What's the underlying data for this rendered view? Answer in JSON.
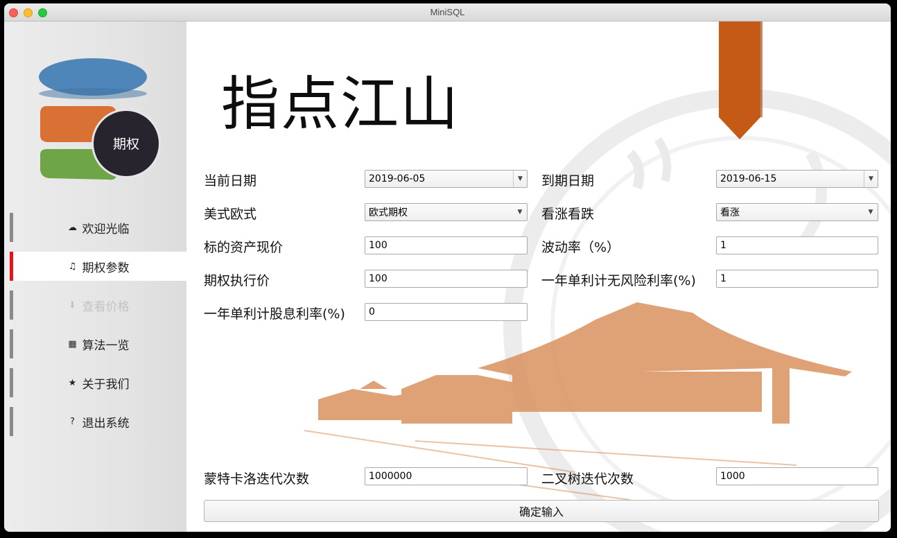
{
  "window": {
    "title": "MiniSQL"
  },
  "logo": {
    "badge": "期权"
  },
  "sidebar": {
    "items": [
      {
        "label": "欢迎光临",
        "icon": "cloud-icon",
        "glyph": "☁",
        "state": "normal"
      },
      {
        "label": "期权参数",
        "icon": "music-note-icon",
        "glyph": "♫",
        "state": "active"
      },
      {
        "label": "查看价格",
        "icon": "download-icon",
        "glyph": "⬇",
        "state": "disabled"
      },
      {
        "label": "算法一览",
        "icon": "film-icon",
        "glyph": "▦",
        "state": "normal"
      },
      {
        "label": "关于我们",
        "icon": "star-icon",
        "glyph": "★",
        "state": "normal"
      },
      {
        "label": "退出系统",
        "icon": "question-icon",
        "glyph": "?",
        "state": "normal"
      }
    ]
  },
  "main": {
    "heading": "指点江山",
    "form": {
      "current_date_label": "当前日期",
      "current_date_value": "2019-06-05",
      "expiry_date_label": "到期日期",
      "expiry_date_value": "2019-06-15",
      "style_label": "美式欧式",
      "style_value": "欧式期权",
      "direction_label": "看涨看跌",
      "direction_value": "看涨",
      "spot_label": "标的资产现价",
      "spot_value": "100",
      "vol_label": "波动率（%）",
      "vol_value": "1",
      "strike_label": "期权执行价",
      "strike_value": "100",
      "rf_label": "一年单利计无风险利率(%)",
      "rf_value": "1",
      "div_label": "一年单利计股息利率(%)",
      "div_value": "0",
      "mc_label": "蒙特卡洛迭代次数",
      "mc_value": "1000000",
      "tree_label": "二叉树迭代次数",
      "tree_value": "1000",
      "submit_label": "确定输入"
    }
  },
  "colors": {
    "accent_red": "#e8131b",
    "ribbon_orange": "#c55a17",
    "logo_blue": "#4f86b9",
    "logo_orange": "#d87133",
    "logo_green": "#6ea546",
    "logo_badge": "#27242e",
    "building_tint": "#d9925f"
  }
}
